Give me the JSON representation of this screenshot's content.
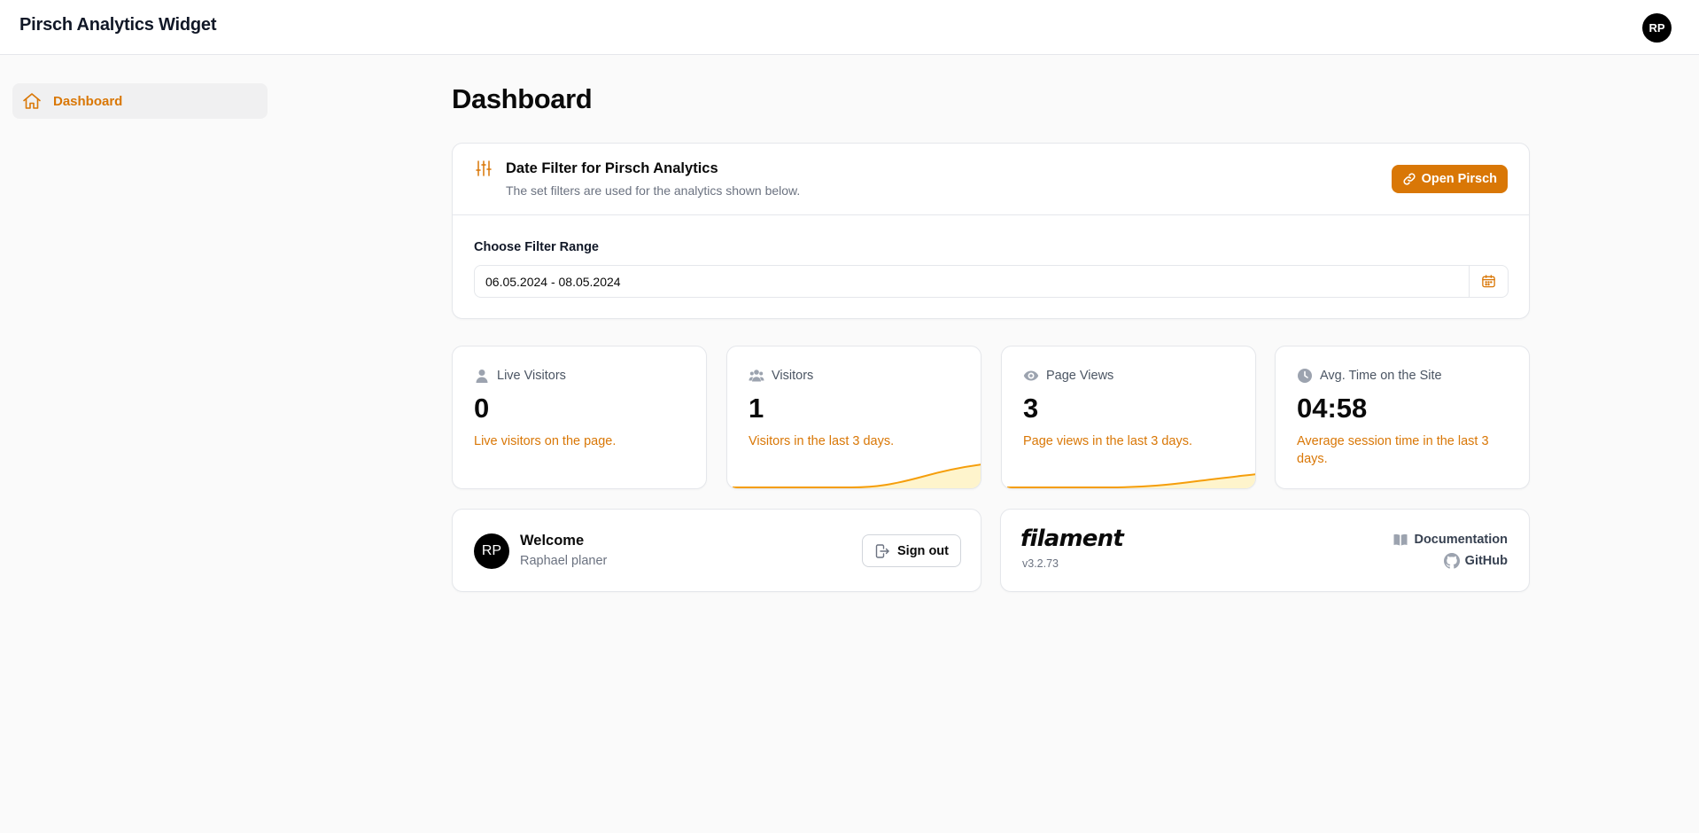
{
  "app": {
    "title": "Pirsch Analytics Widget",
    "user_initials": "RP"
  },
  "sidebar": {
    "items": [
      {
        "label": "Dashboard",
        "icon": "home-icon",
        "active": true
      }
    ]
  },
  "page": {
    "title": "Dashboard"
  },
  "filter": {
    "title": "Date Filter for Pirsch Analytics",
    "description": "The set filters are used for the analytics shown below.",
    "open_button": "Open Pirsch",
    "range_label": "Choose Filter Range",
    "range_value": "06.05.2024 - 08.05.2024"
  },
  "stats": [
    {
      "label": "Live Visitors",
      "value": "0",
      "description": "Live visitors on the page.",
      "icon": "user-icon"
    },
    {
      "label": "Visitors",
      "value": "1",
      "description": "Visitors in the last 3 days.",
      "icon": "users-icon"
    },
    {
      "label": "Page Views",
      "value": "3",
      "description": "Page views in the last 3 days.",
      "icon": "eye-icon"
    },
    {
      "label": "Avg. Time on the Site",
      "value": "04:58",
      "description": "Average session time in the last 3 days.",
      "icon": "clock-icon"
    }
  ],
  "welcome": {
    "title": "Welcome",
    "name": "Raphael planer",
    "initials": "RP",
    "sign_out": "Sign out"
  },
  "filament": {
    "logo": "filament",
    "version": "v3.2.73",
    "documentation": "Documentation",
    "github": "GitHub"
  },
  "colors": {
    "accent": "#d97706",
    "spark_fill": "#fef3c7"
  }
}
